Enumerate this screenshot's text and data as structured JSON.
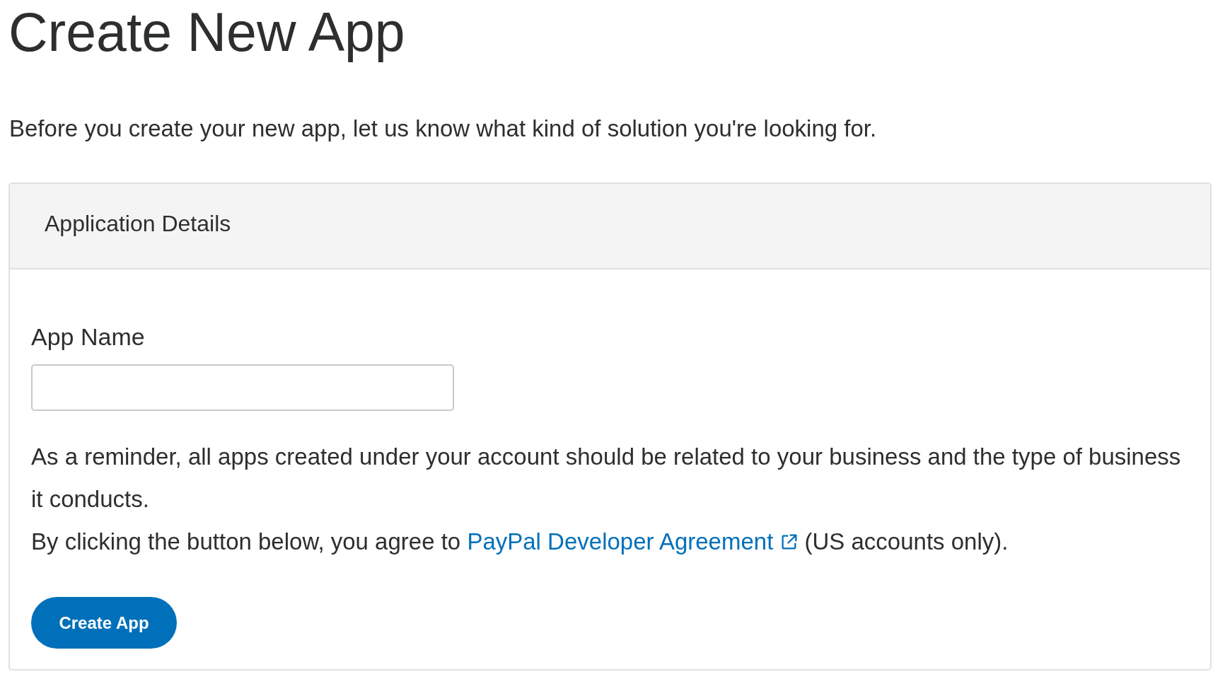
{
  "page": {
    "title": "Create New App",
    "intro": "Before you create your new app, let us know what kind of solution you're looking for."
  },
  "card": {
    "header": "Application Details",
    "field": {
      "label": "App Name"
    },
    "reminder": "As a reminder, all apps created under your account should be related to your business and the type of business it conducts.",
    "agreement": {
      "before": "By clicking the button below, you agree to",
      "link": "PayPal Developer Agreement",
      "after": "(US accounts only)."
    },
    "button": "Create App"
  }
}
